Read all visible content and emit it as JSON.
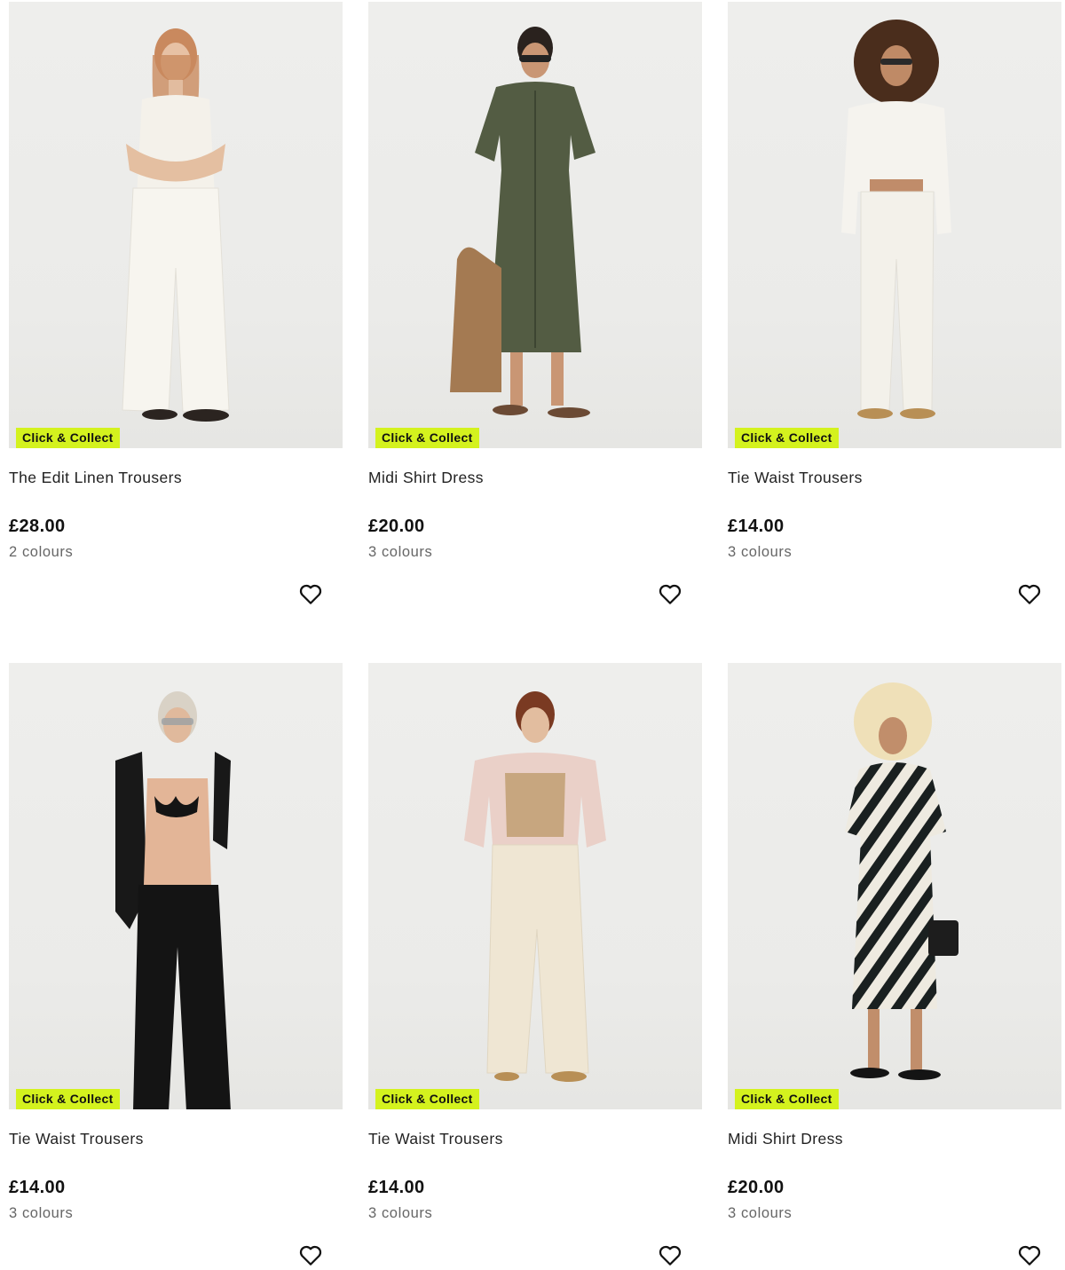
{
  "badge_color": "#d4f21e",
  "products": [
    {
      "name": "The Edit Linen Trousers",
      "price": "£28.00",
      "colours": "2 colours",
      "badge": "Click & Collect",
      "image": "model-white-vest-linen-trousers",
      "wishlist_icon": "heart-outline-icon"
    },
    {
      "name": "Midi Shirt Dress",
      "price": "£20.00",
      "colours": "3 colours",
      "badge": "Click & Collect",
      "image": "model-khaki-shirt-dress",
      "wishlist_icon": "heart-outline-icon"
    },
    {
      "name": "Tie Waist Trousers",
      "price": "£14.00",
      "colours": "3 colours",
      "badge": "Click & Collect",
      "image": "model-white-shirt-trousers",
      "wishlist_icon": "heart-outline-icon"
    },
    {
      "name": "Tie Waist Trousers",
      "price": "£14.00",
      "colours": "3 colours",
      "badge": "Click & Collect",
      "image": "model-black-trousers-bikini",
      "wishlist_icon": "heart-outline-icon"
    },
    {
      "name": "Tie Waist Trousers",
      "price": "£14.00",
      "colours": "3 colours",
      "badge": "Click & Collect",
      "image": "model-cream-trousers-jacket",
      "wishlist_icon": "heart-outline-icon"
    },
    {
      "name": "Midi Shirt Dress",
      "price": "£20.00",
      "colours": "3 colours",
      "badge": "Click & Collect",
      "image": "model-print-shirt-dress",
      "wishlist_icon": "heart-outline-icon"
    }
  ]
}
